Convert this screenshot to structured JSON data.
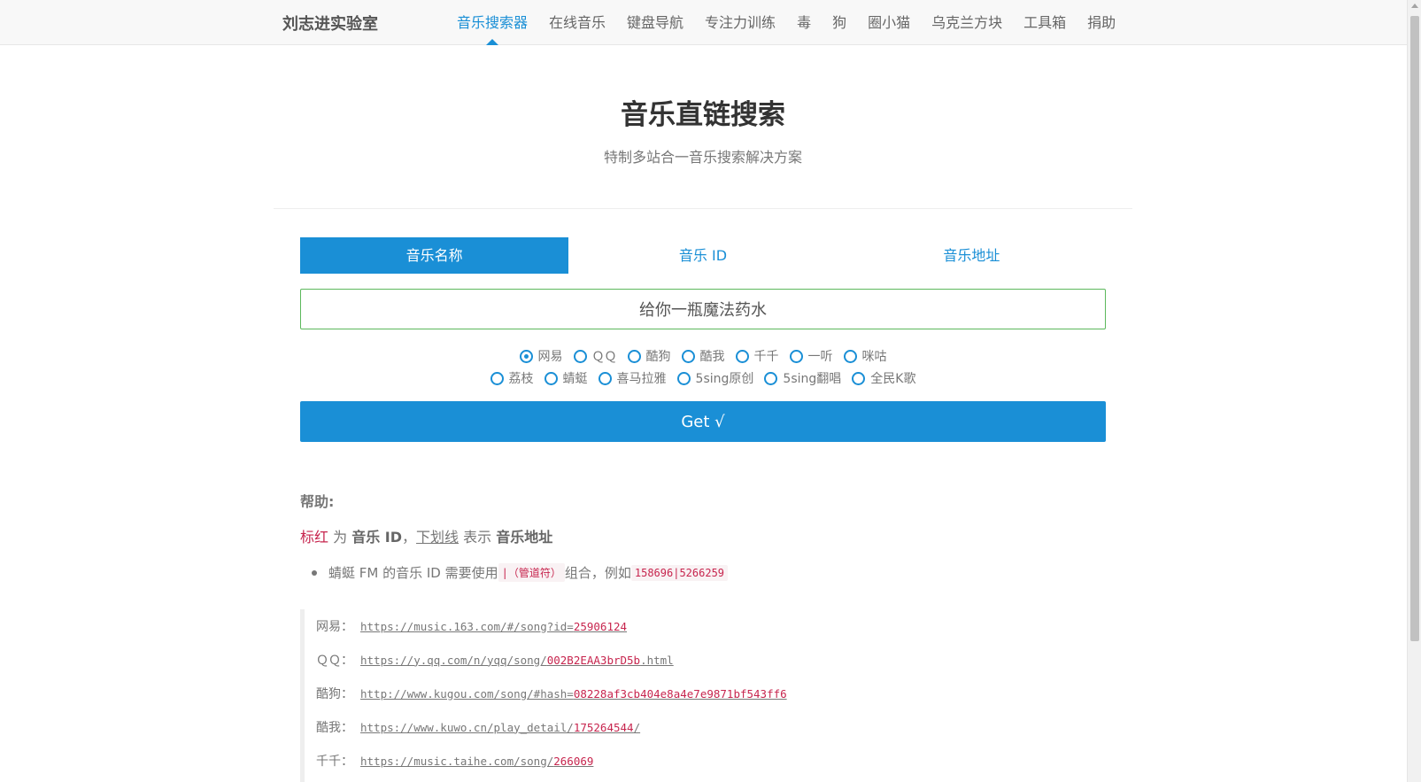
{
  "navbar": {
    "brand": "刘志进实验室",
    "items": [
      {
        "label": "音乐搜索器",
        "active": true
      },
      {
        "label": "在线音乐",
        "active": false
      },
      {
        "label": "键盘导航",
        "active": false
      },
      {
        "label": "专注力训练",
        "active": false
      },
      {
        "label": "毒",
        "active": false
      },
      {
        "label": "狗",
        "active": false
      },
      {
        "label": "圈小猫",
        "active": false
      },
      {
        "label": "乌克兰方块",
        "active": false
      },
      {
        "label": "工具箱",
        "active": false
      },
      {
        "label": "捐助",
        "active": false
      }
    ]
  },
  "header": {
    "title": "音乐直链搜索",
    "subtitle": "特制多站合一音乐搜索解决方案"
  },
  "tabs": [
    {
      "label": "音乐名称",
      "active": true
    },
    {
      "label": "音乐 ID",
      "active": false
    },
    {
      "label": "音乐地址",
      "active": false
    }
  ],
  "search": {
    "value": "给你一瓶魔法药水"
  },
  "sources": {
    "row1": [
      {
        "label": "网易",
        "checked": true
      },
      {
        "label": "ＱＱ",
        "checked": false
      },
      {
        "label": "酷狗",
        "checked": false
      },
      {
        "label": "酷我",
        "checked": false
      },
      {
        "label": "千千",
        "checked": false
      },
      {
        "label": "一听",
        "checked": false
      },
      {
        "label": "咪咕",
        "checked": false
      }
    ],
    "row2": [
      {
        "label": "荔枝",
        "checked": false
      },
      {
        "label": "蜻蜓",
        "checked": false
      },
      {
        "label": "喜马拉雅",
        "checked": false
      },
      {
        "label": "5sing原创",
        "checked": false
      },
      {
        "label": "5sing翻唱",
        "checked": false
      },
      {
        "label": "全民K歌",
        "checked": false
      }
    ]
  },
  "get_button": "Get √",
  "help": {
    "title": "帮助:",
    "line": {
      "red_text": "标红",
      "t1": " 为 ",
      "bold1": "音乐 ID",
      "t2": "，",
      "underline": "下划线",
      "t3": " 表示 ",
      "bold2": "音乐地址"
    },
    "bullet": {
      "t1": "蜻蜓 FM 的音乐 ID 需要使用 ",
      "code1": "|（管道符）",
      "t2": " 组合，例如 ",
      "code2": "158696|5266259"
    }
  },
  "examples": [
    {
      "label": "网易：",
      "url": "https://music.163.com/#/song?id=",
      "id": "25906124",
      "suffix": ""
    },
    {
      "label": "ＱＱ：",
      "url": "https://y.qq.com/n/yqq/song/",
      "id": "002B2EAA3brD5b",
      "suffix": ".html"
    },
    {
      "label": "酷狗：",
      "url": "http://www.kugou.com/song/#hash=",
      "id": "08228af3cb404e8a4e7e9871bf543ff6",
      "suffix": ""
    },
    {
      "label": "酷我：",
      "url": "https://www.kuwo.cn/play_detail/",
      "id": "175264544",
      "suffix": "/"
    },
    {
      "label": "千千：",
      "url": "https://music.taihe.com/song/",
      "id": "266069",
      "suffix": ""
    }
  ]
}
